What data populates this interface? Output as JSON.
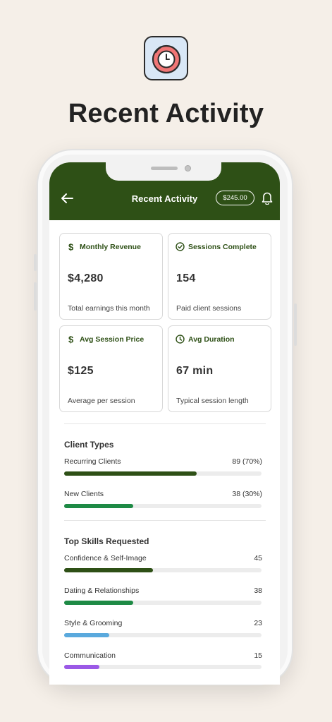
{
  "page": {
    "headline": "Recent Activity",
    "app_icon": "stopwatch-icon"
  },
  "header": {
    "title": "Recent Activity",
    "balance": "$245.00",
    "back_icon": "arrow-left-icon",
    "notification_icon": "bell-icon"
  },
  "stats": [
    {
      "icon": "dollar-icon",
      "title": "Monthly Revenue",
      "value": "$4,280",
      "subtitle": "Total earnings this month"
    },
    {
      "icon": "check-circle-icon",
      "title": "Sessions Complete",
      "value": "154",
      "subtitle": "Paid client sessions"
    },
    {
      "icon": "dollar-icon",
      "title": "Avg Session Price",
      "value": "$125",
      "subtitle": "Average per session"
    },
    {
      "icon": "clock-icon",
      "title": "Avg Duration",
      "value": "67 min",
      "subtitle": "Typical session length"
    }
  ],
  "client_types": {
    "title": "Client Types",
    "rows": [
      {
        "label": "Recurring Clients",
        "value": "89 (70%)",
        "fraction": 0.67,
        "color": "#2e5016"
      },
      {
        "label": "New Clients",
        "value": "38 (30%)",
        "fraction": 0.35,
        "color": "#1e8a45"
      }
    ]
  },
  "top_skills": {
    "title": "Top Skills Requested",
    "rows": [
      {
        "label": "Confidence & Self-Image",
        "value": "45",
        "fraction": 0.45,
        "color": "#2e5016"
      },
      {
        "label": "Dating & Relationships",
        "value": "38",
        "fraction": 0.35,
        "color": "#1e8a45"
      },
      {
        "label": "Style & Grooming",
        "value": "23",
        "fraction": 0.23,
        "color": "#5aa9dd"
      },
      {
        "label": "Communication",
        "value": "15",
        "fraction": 0.18,
        "color": "#9b59e6"
      }
    ]
  },
  "colors": {
    "brand": "#2e5016",
    "background": "#f5efe8"
  }
}
